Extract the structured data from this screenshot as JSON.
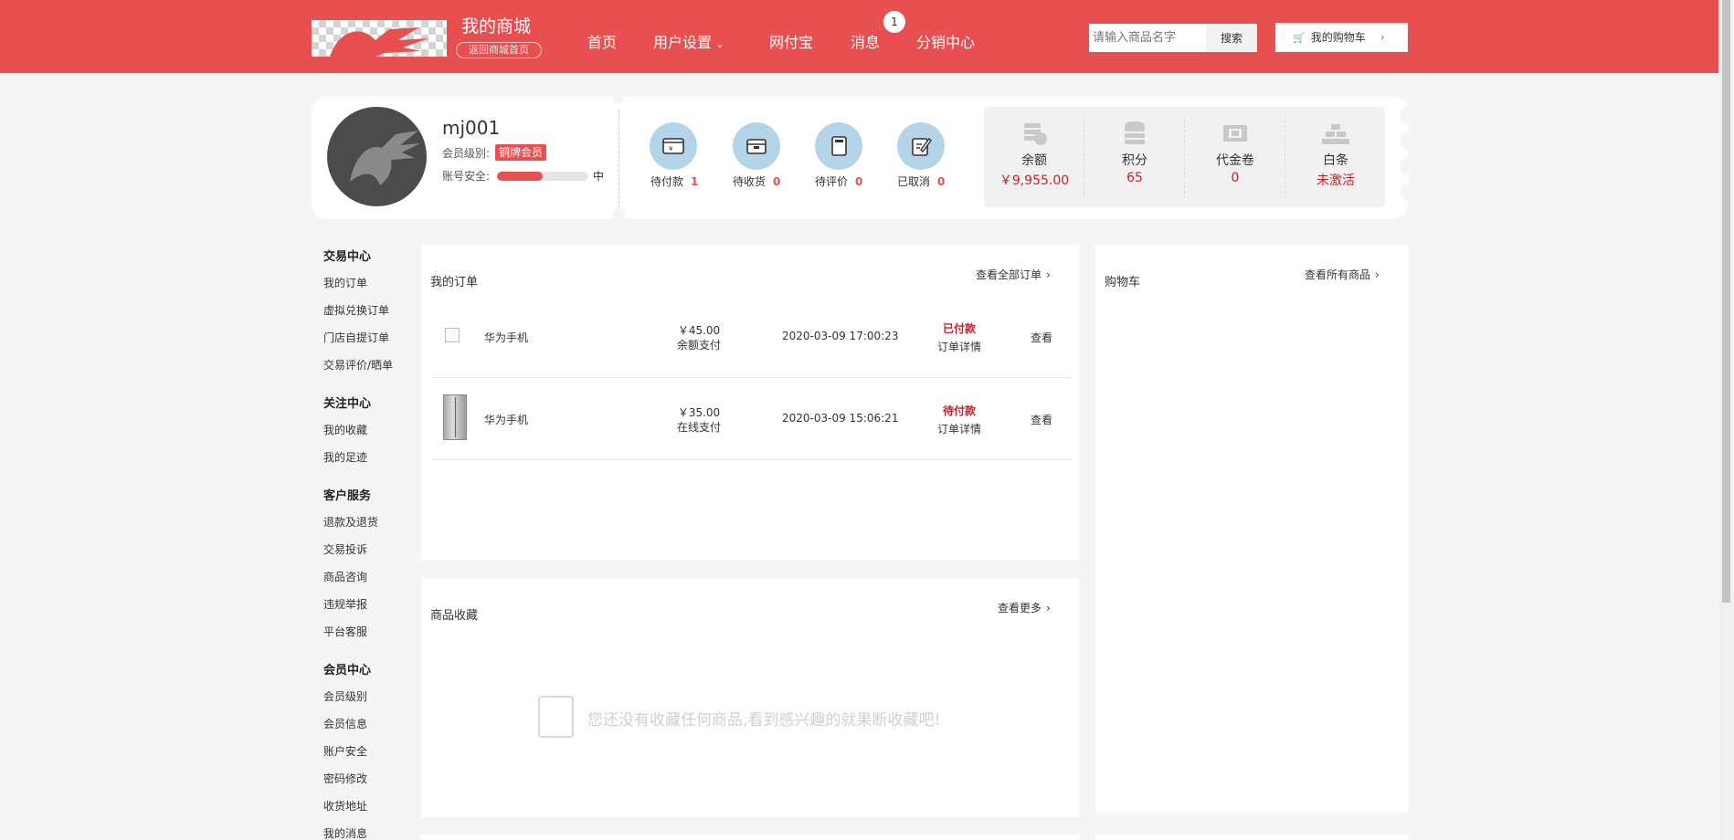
{
  "header": {
    "shop_title": "我的商城",
    "back_home": "返回商城首页",
    "nav": [
      "首页",
      "用户设置",
      "网付宝",
      "消息",
      "分销中心"
    ],
    "message_count": "1",
    "search_placeholder": "请输入商品名字",
    "search_button": "搜索",
    "cart_button": "我的购物车"
  },
  "profile": {
    "username": "mj001",
    "level_label": "会员级别:",
    "level_badge": "铜牌会员",
    "security_label": "账号安全:",
    "security_level": "中",
    "security_progress_percent": 50
  },
  "order_status": [
    {
      "label": "待付款",
      "count": "1",
      "icon": "wallet-icon"
    },
    {
      "label": "待收货",
      "count": "0",
      "icon": "package-icon"
    },
    {
      "label": "待评价",
      "count": "0",
      "icon": "review-icon"
    },
    {
      "label": "已取消",
      "count": "0",
      "icon": "edit-icon"
    }
  ],
  "assets": [
    {
      "title": "余额",
      "value": "￥9,955.00",
      "icon": "coins-icon"
    },
    {
      "title": "积分",
      "value": "65",
      "icon": "database-icon"
    },
    {
      "title": "代金卷",
      "value": "0",
      "icon": "voucher-icon"
    },
    {
      "title": "白条",
      "value": "未激活",
      "icon": "gold-bars-icon"
    }
  ],
  "menu": {
    "sections": [
      {
        "title": "交易中心",
        "items": [
          "我的订单",
          "虚拟兑换订单",
          "门店自提订单",
          "交易评价/晒单"
        ]
      },
      {
        "title": "关注中心",
        "items": [
          "我的收藏",
          "我的足迹"
        ]
      },
      {
        "title": "客户服务",
        "items": [
          "退款及退货",
          "交易投诉",
          "商品咨询",
          "违规举报",
          "平台客服"
        ]
      },
      {
        "title": "会员中心",
        "items": [
          "会员级别",
          "会员信息",
          "账户安全",
          "密码修改",
          "收货地址",
          "我的消息"
        ]
      }
    ]
  },
  "orders_panel": {
    "title": "我的订单",
    "more": "查看全部订单",
    "rows": [
      {
        "product": "华为手机",
        "price": "￥45.00",
        "pay_method": "余额支付",
        "time": "2020-03-09 17:00:23",
        "status": "已付款",
        "detail": "订单详情",
        "view": "查看"
      },
      {
        "product": "华为手机",
        "price": "￥35.00",
        "pay_method": "在线支付",
        "time": "2020-03-09 15:06:21",
        "status": "待付款",
        "detail": "订单详情",
        "view": "查看"
      }
    ]
  },
  "favorites_panel": {
    "title": "商品收藏",
    "more": "查看更多",
    "empty_text": "您还没有收藏任何商品,看到感兴趣的就果断收藏吧!"
  },
  "cart_panel": {
    "title": "购物车",
    "more": "查看所有商品"
  },
  "colors": {
    "brand": "#e84f50",
    "status_red": "#c7202a",
    "icon_circle": "#b4d4ea"
  }
}
